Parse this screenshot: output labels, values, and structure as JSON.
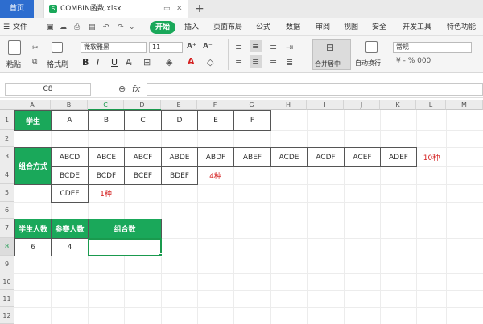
{
  "tabs": {
    "home": "首页",
    "file": "COMBIN函数.xlsx",
    "new_tab": "+"
  },
  "menu": {
    "file": "文件",
    "start": "开始",
    "items": [
      "插入",
      "页面布局",
      "公式",
      "数据",
      "审阅",
      "视图",
      "安全",
      "开发工具",
      "特色功能"
    ]
  },
  "ribbon": {
    "paste": "粘贴",
    "format_painter": "格式刷",
    "font_name": "微软雅黑",
    "font_size": "11",
    "bold": "B",
    "italic": "I",
    "underline": "U",
    "merge": "合并居中",
    "wrap": "自动换行",
    "number_format": "常规"
  },
  "formula": {
    "name_box": "C8",
    "fx": "fx",
    "content": ""
  },
  "columns": [
    "A",
    "B",
    "C",
    "D",
    "E",
    "F",
    "G",
    "H",
    "I",
    "J",
    "K",
    "L",
    "M"
  ],
  "rows": [
    "1",
    "2",
    "3",
    "4",
    "5",
    "6",
    "7",
    "8",
    "9",
    "10",
    "11",
    "12"
  ],
  "sheet": {
    "row1": {
      "label": "学生",
      "values": [
        "A",
        "B",
        "C",
        "D",
        "E",
        "F"
      ]
    },
    "combo_label": "组合方式",
    "row3": [
      "ABCD",
      "ABCE",
      "ABCF",
      "ABDE",
      "ABDF",
      "ABEF",
      "ACDE",
      "ACDF",
      "ACEF",
      "ADEF"
    ],
    "row3_note": "10种",
    "row4": [
      "BCDE",
      "BCDF",
      "BCEF",
      "BDEF"
    ],
    "row4_note": "4种",
    "row5": [
      "CDEF"
    ],
    "row5_note": "1种",
    "row7": [
      "学生人数",
      "参赛人数",
      "组合数"
    ],
    "row8": [
      "6",
      "4",
      ""
    ]
  },
  "colors": {
    "accent": "#1aa85a",
    "note": "#d42020",
    "tab_blue": "#2d6dcf"
  }
}
